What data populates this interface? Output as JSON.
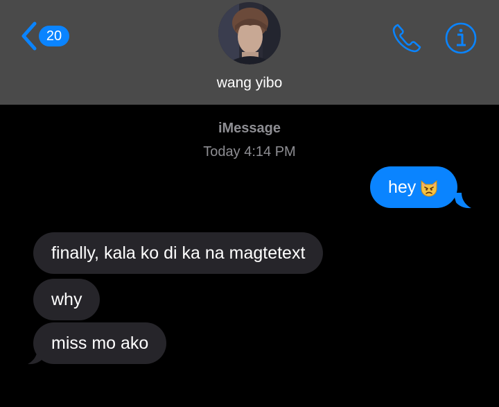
{
  "header": {
    "back_count": "20",
    "contact_name": "wang yibo"
  },
  "thread": {
    "service": "iMessage",
    "timestamp": "Today 4:14 PM"
  },
  "messages": [
    {
      "direction": "outgoing",
      "text": "hey",
      "emoji": "pouting-cat-emoji"
    },
    {
      "direction": "incoming",
      "text": "finally, kala ko di ka na magtetext"
    },
    {
      "direction": "incoming",
      "text": "why"
    },
    {
      "direction": "incoming",
      "text": "miss mo ako"
    }
  ],
  "colors": {
    "header_bg": "#4a4a4a",
    "accent_blue": "#0a84ff",
    "incoming_bubble": "#26252a",
    "background": "#000000",
    "meta_text": "#8e8e93"
  },
  "icons": {
    "back": "chevron-left-icon",
    "phone": "phone-icon",
    "info": "info-icon"
  }
}
